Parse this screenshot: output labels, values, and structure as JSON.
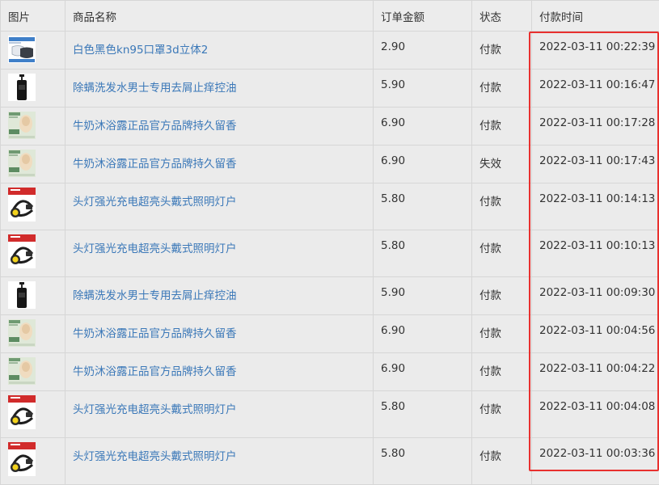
{
  "columns": {
    "image": "图片",
    "name": "商品名称",
    "amount": "订单金额",
    "status": "状态",
    "paid_time": "付款时间"
  },
  "colors": {
    "link": "#3b78b8",
    "highlight": "#e8302e"
  },
  "rows": [
    {
      "thumb": "mask-product-icon",
      "name": "白色黑色kn95口罩3d立体2",
      "amount": "2.90",
      "status": "付款",
      "time": "2022-03-11 00:22:39"
    },
    {
      "thumb": "shampoo-bottle-icon",
      "name": "除螨洗发水男士专用去屑止痒控油",
      "amount": "5.90",
      "status": "付款",
      "time": "2022-03-11 00:16:47"
    },
    {
      "thumb": "body-wash-icon",
      "name": "牛奶沐浴露正品官方品牌持久留香",
      "amount": "6.90",
      "status": "付款",
      "time": "2022-03-11 00:17:28"
    },
    {
      "thumb": "body-wash-icon",
      "name": "牛奶沐浴露正品官方品牌持久留香",
      "amount": "6.90",
      "status": "失效",
      "time": "2022-03-11 00:17:43"
    },
    {
      "thumb": "headlamp-icon",
      "name": "头灯强光充电超亮头戴式照明灯户",
      "amount": "5.80",
      "status": "付款",
      "time": "2022-03-11 00:14:13"
    },
    {
      "thumb": "headlamp-icon",
      "name": "头灯强光充电超亮头戴式照明灯户",
      "amount": "5.80",
      "status": "付款",
      "time": "2022-03-11 00:10:13"
    },
    {
      "thumb": "shampoo-bottle-icon",
      "name": "除螨洗发水男士专用去屑止痒控油",
      "amount": "5.90",
      "status": "付款",
      "time": "2022-03-11 00:09:30"
    },
    {
      "thumb": "body-wash-icon",
      "name": "牛奶沐浴露正品官方品牌持久留香",
      "amount": "6.90",
      "status": "付款",
      "time": "2022-03-11 00:04:56"
    },
    {
      "thumb": "body-wash-icon",
      "name": "牛奶沐浴露正品官方品牌持久留香",
      "amount": "6.90",
      "status": "付款",
      "time": "2022-03-11 00:04:22"
    },
    {
      "thumb": "headlamp-icon",
      "name": "头灯强光充电超亮头戴式照明灯户",
      "amount": "5.80",
      "status": "付款",
      "time": "2022-03-11 00:04:08"
    },
    {
      "thumb": "headlamp-icon",
      "name": "头灯强光充电超亮头戴式照明灯户",
      "amount": "5.80",
      "status": "付款",
      "time": "2022-03-11 00:03:36"
    }
  ]
}
